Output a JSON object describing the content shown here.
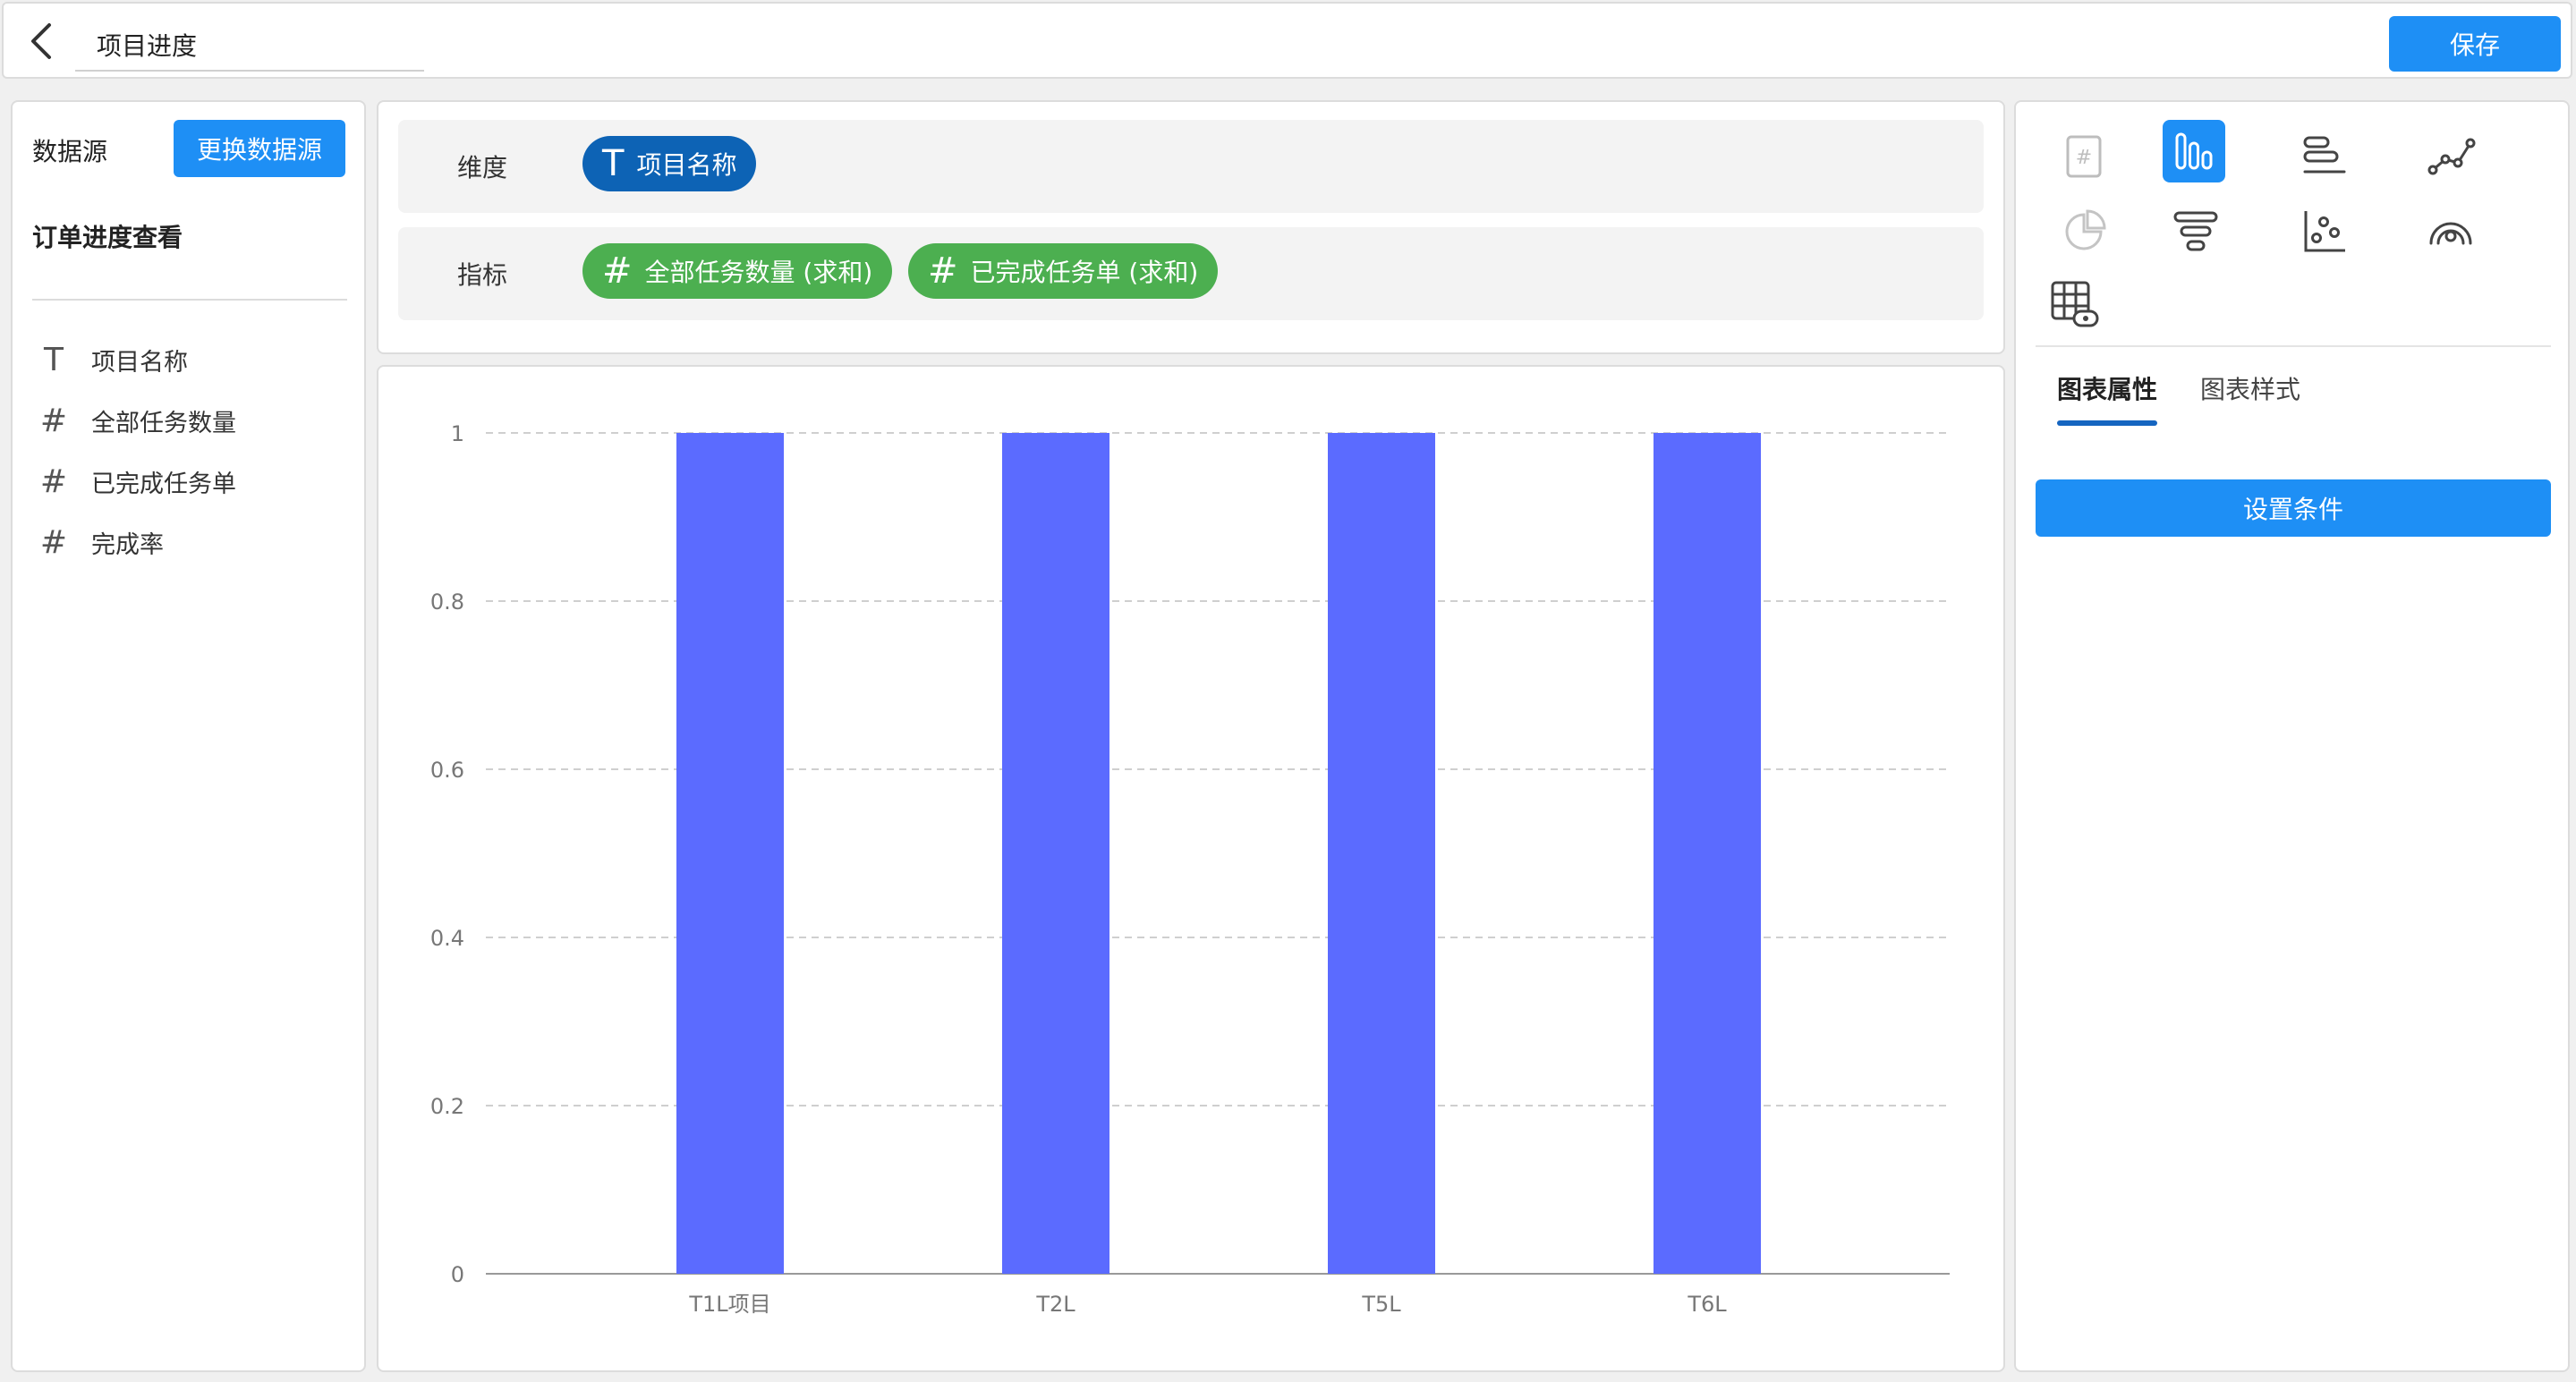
{
  "header": {
    "title": "项目进度",
    "save_label": "保存"
  },
  "left": {
    "datasource_label": "数据源",
    "change_button": "更换数据源",
    "dataset_name": "订单进度查看",
    "fields": [
      {
        "type": "text",
        "icon": "T",
        "label": "项目名称"
      },
      {
        "type": "number",
        "icon": "#",
        "label": "全部任务数量"
      },
      {
        "type": "number",
        "icon": "#",
        "label": "已完成任务单"
      },
      {
        "type": "number",
        "icon": "#",
        "label": "完成率"
      }
    ]
  },
  "config": {
    "dimension_label": "维度",
    "dimension_pill": {
      "icon": "T",
      "label": "项目名称"
    },
    "metric_label": "指标",
    "metric_pills": [
      {
        "icon": "#",
        "label": "全部任务数量 (求和)"
      },
      {
        "icon": "#",
        "label": "已完成任务单 (求和)"
      }
    ]
  },
  "chart_data": {
    "type": "bar",
    "categories": [
      "T1L项目",
      "T2L",
      "T5L",
      "T6L"
    ],
    "values": [
      1,
      1,
      1,
      1
    ],
    "title": "",
    "xlabel": "",
    "ylabel": "",
    "ylim": [
      0,
      1
    ],
    "yticks": [
      "0",
      "0.2",
      "0.4",
      "0.6",
      "0.8",
      "1"
    ],
    "grid": true,
    "bar_color": "#5b6bff"
  },
  "right": {
    "chart_types": [
      {
        "name": "number-card-icon",
        "active": false
      },
      {
        "name": "bar-chart-icon",
        "active": true
      },
      {
        "name": "horizontal-bar-icon",
        "active": false
      },
      {
        "name": "line-chart-icon",
        "active": false
      },
      {
        "name": "pie-chart-icon",
        "active": false
      },
      {
        "name": "funnel-chart-icon",
        "active": false
      },
      {
        "name": "scatter-chart-icon",
        "active": false
      },
      {
        "name": "radar-chart-icon",
        "active": false
      },
      {
        "name": "table-chart-icon",
        "active": false
      }
    ],
    "tabs": [
      "图表属性",
      "图表样式"
    ],
    "condition_button": "设置条件"
  },
  "colors": {
    "primary": "#1e8ff5",
    "dimension_pill": "#0d63b5",
    "metric_pill": "#4caf50"
  }
}
